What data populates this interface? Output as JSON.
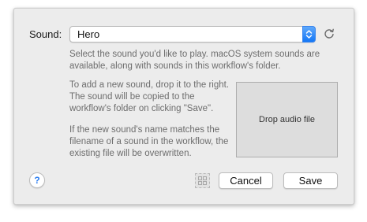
{
  "sound": {
    "label": "Sound:",
    "selected": "Hero"
  },
  "descriptions": {
    "intro": "Select the sound you'd like to play. macOS system sounds are available, along with sounds in this workflow's folder.",
    "add": "To add a new sound, drop it to the right. The sound will be copied to the workflow's folder on clicking \"Save\".",
    "overwrite": "If the new sound's name matches the filename of a sound in the workflow, the existing file will be overwritten."
  },
  "drop_zone": {
    "label": "Drop audio file"
  },
  "buttons": {
    "help": "?",
    "cancel": "Cancel",
    "save": "Save"
  },
  "icons": {
    "select_arrows": "chevron-up-down-icon",
    "refresh": "refresh-icon",
    "grid": "grid-icon"
  },
  "colors": {
    "accent": "#1477f6",
    "help": "#2b7df0",
    "panel": "#ececec"
  }
}
